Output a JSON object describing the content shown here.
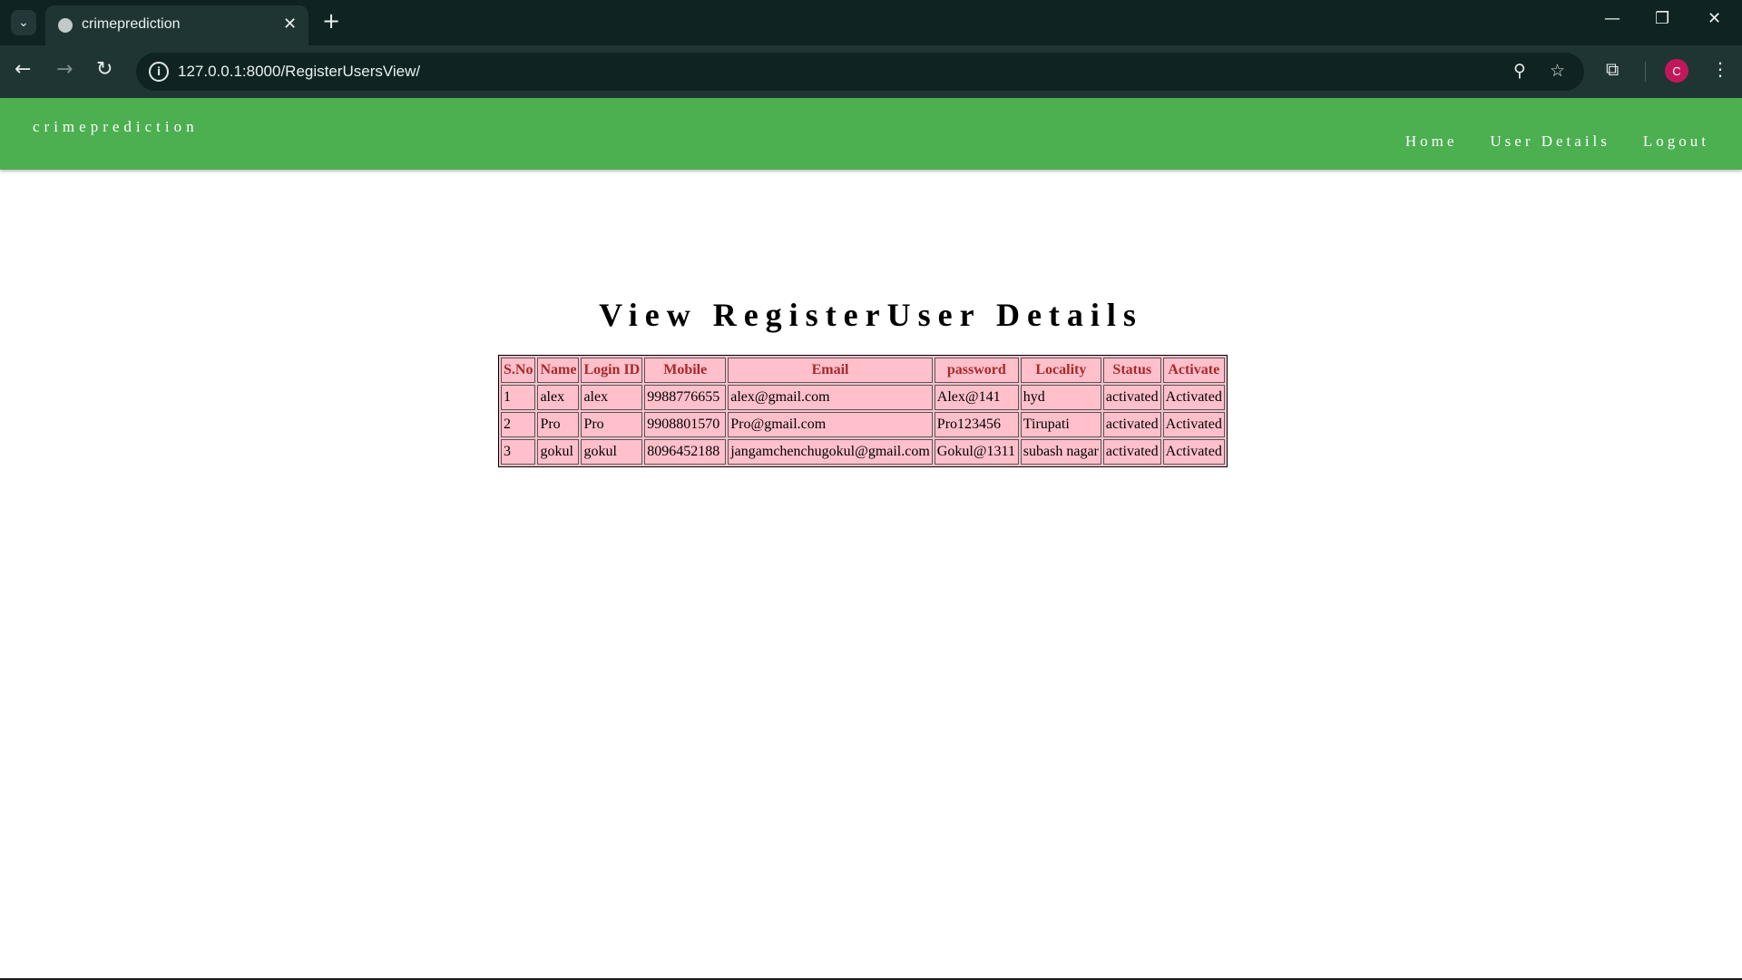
{
  "browser": {
    "tab_title": "crimeprediction",
    "url": "127.0.0.1:8000/RegisterUsersView/",
    "profile_initial": "C"
  },
  "header": {
    "brand": "crimeprediction",
    "nav": [
      "Home",
      "User Details",
      "Logout"
    ]
  },
  "main": {
    "title": "View RegisterUser Details",
    "table": {
      "columns": [
        "S.No",
        "Name",
        "Login ID",
        "Mobile",
        "Email",
        "password",
        "Locality",
        "Status",
        "Activate"
      ],
      "rows": [
        [
          "1",
          "alex",
          "alex",
          "9988776655",
          "alex@gmail.com",
          "Alex@141",
          "hyd",
          "activated",
          "Activated"
        ],
        [
          "2",
          "Pro",
          "Pro",
          "9908801570",
          "Pro@gmail.com",
          "Pro123456",
          "Tirupati",
          "activated",
          "Activated"
        ],
        [
          "3",
          "gokul",
          "gokul",
          "8096452188",
          "jangamchenchugokul@gmail.com",
          "Gokul@1311",
          "subash nagar",
          "activated",
          "Activated"
        ]
      ]
    }
  },
  "colors": {
    "header_bg": "#4caf50",
    "table_bg": "#ffc0cb",
    "header_text": "#a52a2a"
  }
}
